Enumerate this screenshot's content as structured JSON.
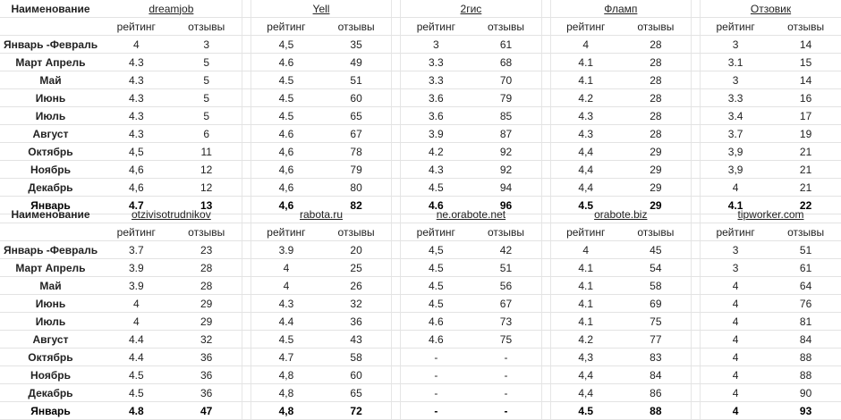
{
  "blocks": [
    {
      "header_label": "Наименование",
      "sites": [
        "dreamjob",
        "Yell",
        "2гис",
        "Фламп",
        "Отзовик"
      ],
      "sub_rating": "рейтинг",
      "sub_reviews": "отзывы",
      "rows": [
        {
          "month": "Январь -Февраль",
          "values": [
            "4",
            "3",
            "4,5",
            "35",
            "3",
            "61",
            "4",
            "28",
            "3",
            "14"
          ]
        },
        {
          "month": "Март  Апрель",
          "values": [
            "4.3",
            "5",
            "4.6",
            "49",
            "3.3",
            "68",
            "4.1",
            "28",
            "3.1",
            "15"
          ]
        },
        {
          "month": "Май",
          "values": [
            "4.3",
            "5",
            "4.5",
            "51",
            "3.3",
            "70",
            "4.1",
            "28",
            "3",
            "14"
          ]
        },
        {
          "month": "Июнь",
          "values": [
            "4.3",
            "5",
            "4.5",
            "60",
            "3.6",
            "79",
            "4.2",
            "28",
            "3.3",
            "16"
          ]
        },
        {
          "month": "Июль",
          "values": [
            "4.3",
            "5",
            "4.5",
            "65",
            "3.6",
            "85",
            "4.3",
            "28",
            "3.4",
            "17"
          ]
        },
        {
          "month": "Август",
          "values": [
            "4.3",
            "6",
            "4.6",
            "67",
            "3.9",
            "87",
            "4.3",
            "28",
            "3.7",
            "19"
          ]
        },
        {
          "month": "Октябрь",
          "values": [
            "4,5",
            "11",
            "4,6",
            "78",
            "4.2",
            "92",
            "4,4",
            "29",
            "3,9",
            "21"
          ]
        },
        {
          "month": "Ноябрь",
          "values": [
            "4,6",
            "12",
            "4,6",
            "79",
            "4.3",
            "92",
            "4,4",
            "29",
            "3,9",
            "21"
          ]
        },
        {
          "month": "Декабрь",
          "values": [
            "4,6",
            "12",
            "4,6",
            "80",
            "4.5",
            "94",
            "4,4",
            "29",
            "4",
            "21"
          ]
        },
        {
          "month": "Январь",
          "bold": true,
          "values": [
            "4.7",
            "13",
            "4,6",
            "82",
            "4.6",
            "96",
            "4.5",
            "29",
            "4.1",
            "22"
          ]
        }
      ]
    },
    {
      "header_label": "Наименование",
      "sites": [
        "otzivisotrudnikov",
        "rabota.ru",
        "ne.orabote.net",
        "orabote.biz",
        "tipworker.com"
      ],
      "sub_rating": "рейтинг",
      "sub_reviews": "отзывы",
      "rows": [
        {
          "month": "Январь -Февраль",
          "values": [
            "3.7",
            "23",
            "3.9",
            "20",
            "4,5",
            "42",
            "4",
            "45",
            "3",
            "51"
          ]
        },
        {
          "month": "Март  Апрель",
          "values": [
            "3.9",
            "28",
            "4",
            "25",
            "4.5",
            "51",
            "4.1",
            "54",
            "3",
            "61"
          ]
        },
        {
          "month": "Май",
          "values": [
            "3.9",
            "28",
            "4",
            "26",
            "4.5",
            "56",
            "4.1",
            "58",
            "4",
            "64"
          ]
        },
        {
          "month": "Июнь",
          "values": [
            "4",
            "29",
            "4.3",
            "32",
            "4.5",
            "67",
            "4.1",
            "69",
            "4",
            "76"
          ]
        },
        {
          "month": "Июль",
          "values": [
            "4",
            "29",
            "4.4",
            "36",
            "4.6",
            "73",
            "4.1",
            "75",
            "4",
            "81"
          ]
        },
        {
          "month": "Август",
          "values": [
            "4.4",
            "32",
            "4.5",
            "43",
            "4.6",
            "75",
            "4.2",
            "77",
            "4",
            "84"
          ]
        },
        {
          "month": "Октябрь",
          "values": [
            "4.4",
            "36",
            "4.7",
            "58",
            "-",
            "-",
            "4,3",
            "83",
            "4",
            "88"
          ]
        },
        {
          "month": "Ноябрь",
          "values": [
            "4.5",
            "36",
            "4,8",
            "60",
            "-",
            "-",
            "4,4",
            "84",
            "4",
            "88"
          ]
        },
        {
          "month": "Декабрь",
          "values": [
            "4.5",
            "36",
            "4,8",
            "65",
            "-",
            "-",
            "4,4",
            "86",
            "4",
            "90"
          ]
        },
        {
          "month": "Январь",
          "bold": true,
          "values": [
            "4.8",
            "47",
            "4,8",
            "72",
            "-",
            "-",
            "4.5",
            "88",
            "4",
            "93"
          ]
        }
      ]
    }
  ]
}
